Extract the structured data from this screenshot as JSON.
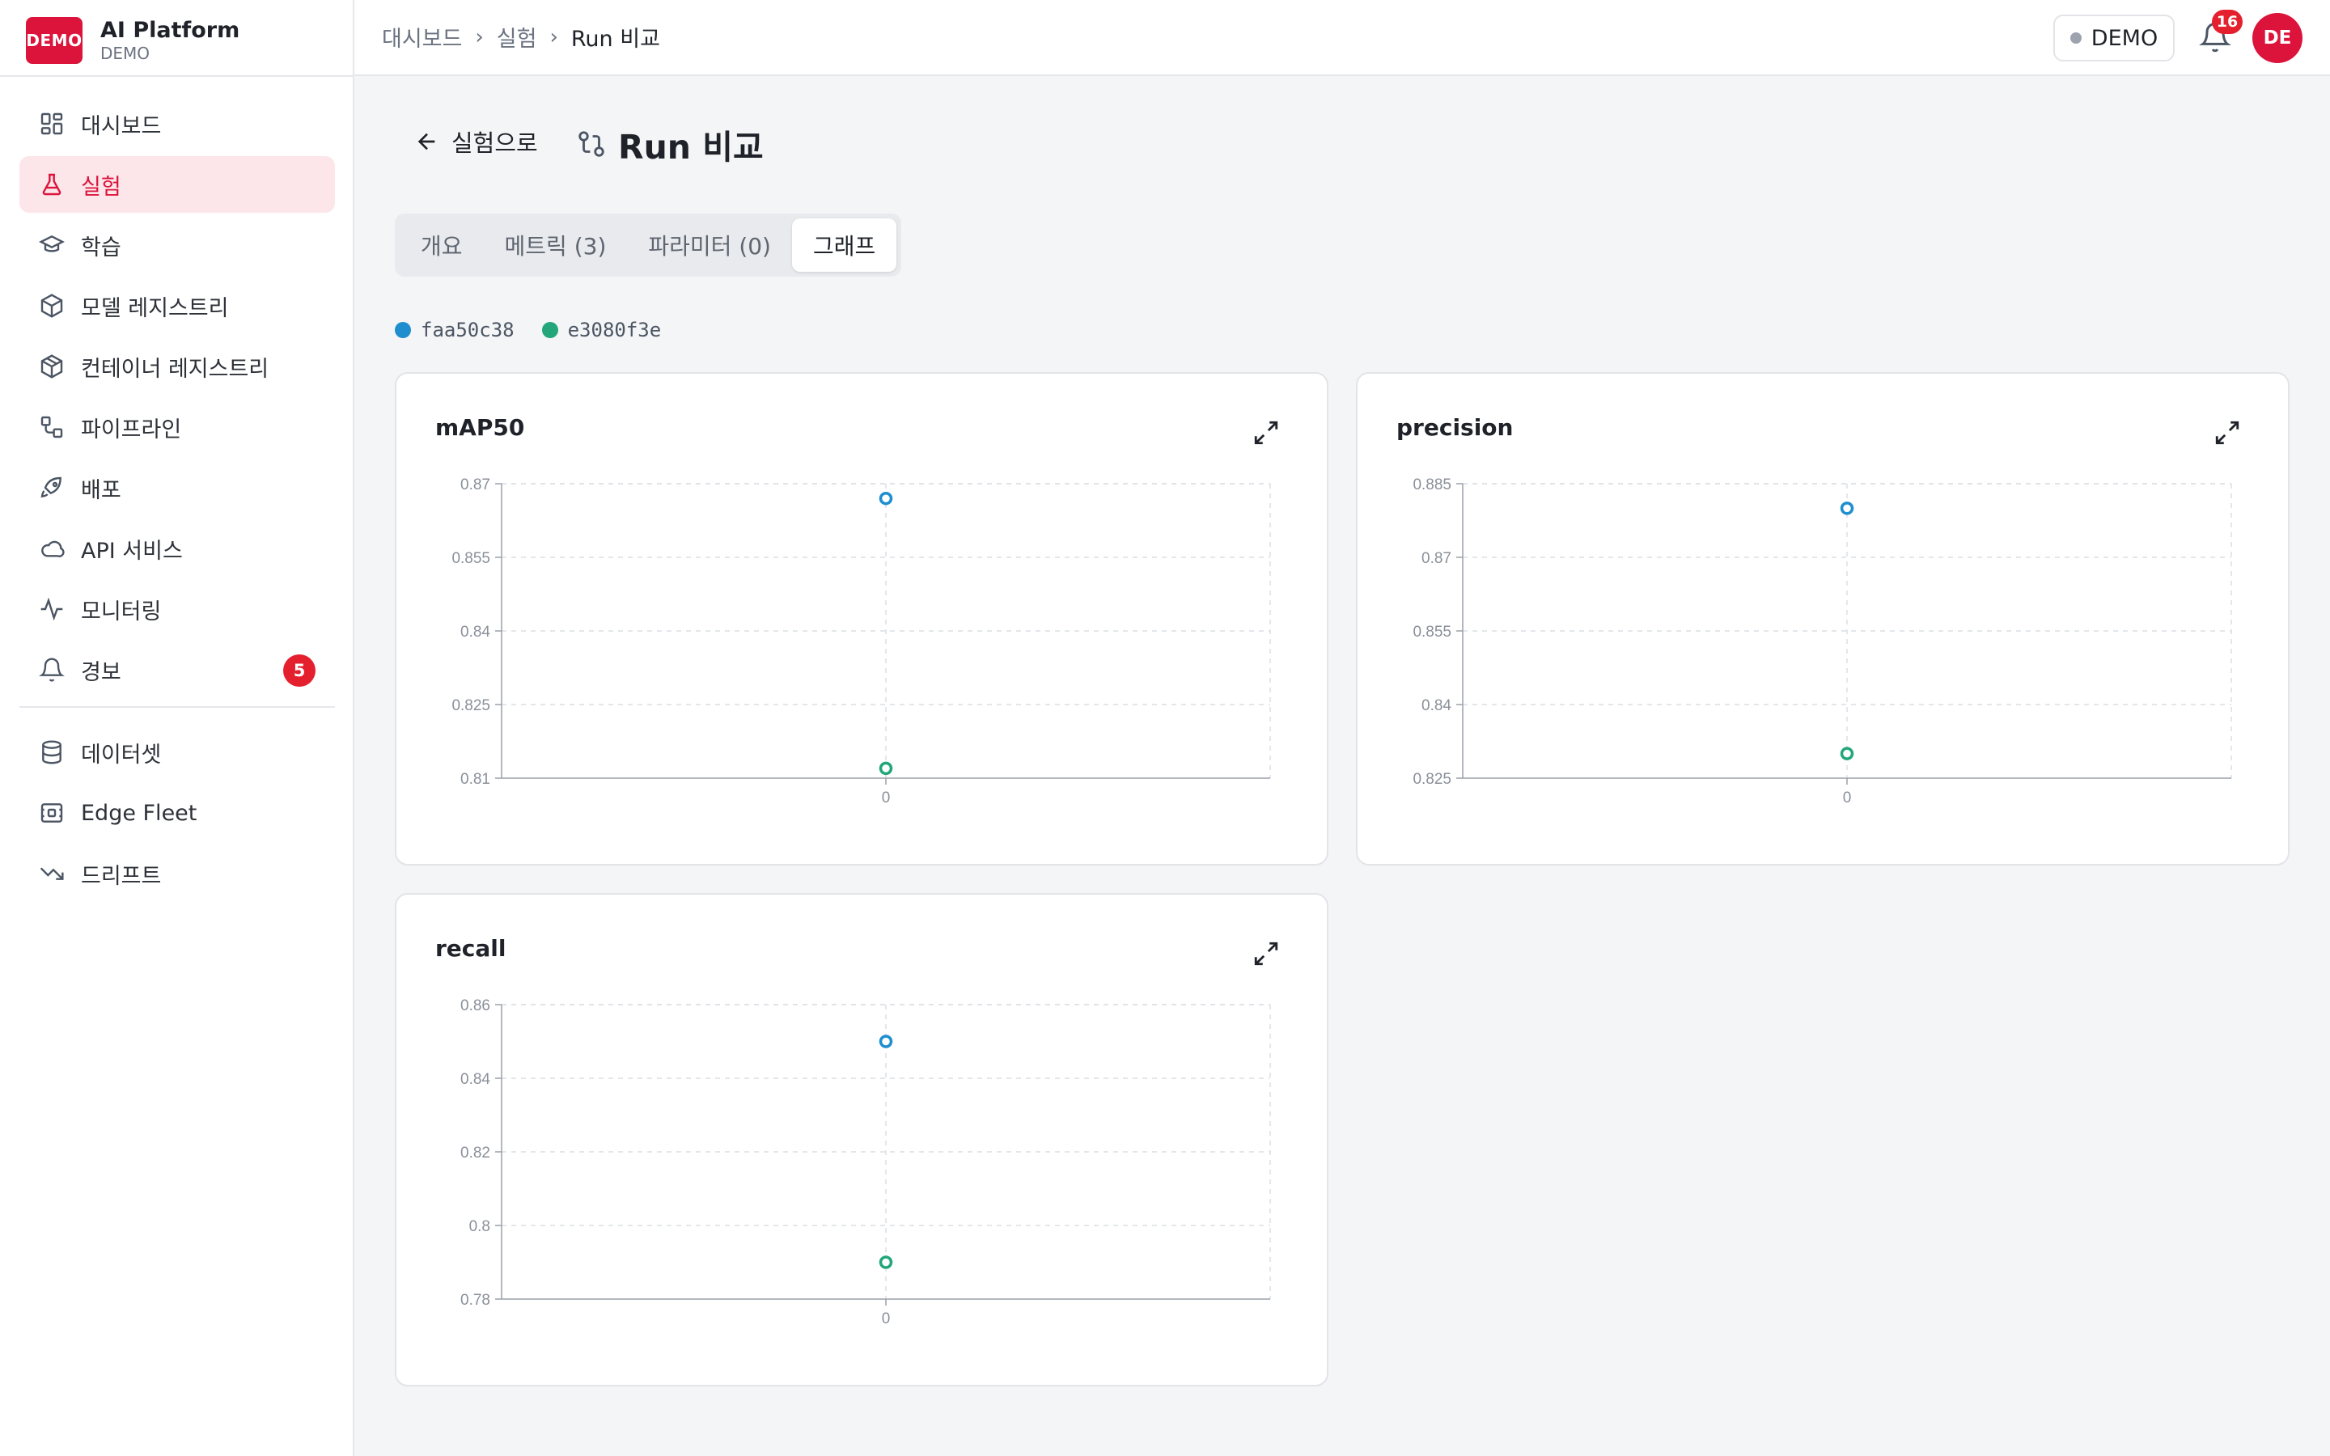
{
  "brand": {
    "logo": "DEMO",
    "title": "AI Platform",
    "subtitle": "DEMO"
  },
  "sidebar": {
    "items": [
      {
        "label": "대시보드",
        "icon": "dashboard-icon"
      },
      {
        "label": "실험",
        "icon": "flask-icon",
        "active": true
      },
      {
        "label": "학습",
        "icon": "graduation-cap-icon"
      },
      {
        "label": "모델 레지스트리",
        "icon": "box-icon"
      },
      {
        "label": "컨테이너 레지스트리",
        "icon": "container-icon"
      },
      {
        "label": "파이프라인",
        "icon": "pipeline-icon"
      },
      {
        "label": "배포",
        "icon": "rocket-icon"
      },
      {
        "label": "API 서비스",
        "icon": "cloud-icon"
      },
      {
        "label": "모니터링",
        "icon": "activity-icon"
      },
      {
        "label": "경보",
        "icon": "bell-icon",
        "badge": "5"
      }
    ],
    "secondary": [
      {
        "label": "데이터셋",
        "icon": "database-icon"
      },
      {
        "label": "Edge Fleet",
        "icon": "edge-device-icon"
      },
      {
        "label": "드리프트",
        "icon": "trending-down-icon"
      }
    ]
  },
  "topbar": {
    "breadcrumb": [
      "대시보드",
      "실험",
      "Run 비교"
    ],
    "env_label": "DEMO",
    "notifications": "16",
    "avatar": "DE"
  },
  "page": {
    "back_label": "실험으로",
    "title": "Run 비교"
  },
  "tabs": [
    "개요",
    "메트릭 (3)",
    "파라미터 (0)",
    "그래프"
  ],
  "active_tab": "그래프",
  "runs": [
    {
      "id": "faa50c38",
      "color": "#1f8ecf"
    },
    {
      "id": "e3080f3e",
      "color": "#22a67a"
    }
  ],
  "colors": {
    "accent": "#dc143c",
    "active_bg": "#fde6ea"
  },
  "chart_data": [
    {
      "type": "scatter",
      "title": "mAP50",
      "x_ticks": [
        "0"
      ],
      "y_ticks": [
        "0.87",
        "0.855",
        "0.84",
        "0.825",
        "0.81"
      ],
      "ylim": [
        0.81,
        0.87
      ],
      "grid": true,
      "series": [
        {
          "name": "faa50c38",
          "x": [
            0
          ],
          "y": [
            0.867
          ]
        },
        {
          "name": "e3080f3e",
          "x": [
            0
          ],
          "y": [
            0.812
          ]
        }
      ]
    },
    {
      "type": "scatter",
      "title": "precision",
      "x_ticks": [
        "0"
      ],
      "y_ticks": [
        "0.885",
        "0.87",
        "0.855",
        "0.84",
        "0.825"
      ],
      "ylim": [
        0.825,
        0.885
      ],
      "grid": true,
      "series": [
        {
          "name": "faa50c38",
          "x": [
            0
          ],
          "y": [
            0.88
          ]
        },
        {
          "name": "e3080f3e",
          "x": [
            0
          ],
          "y": [
            0.83
          ]
        }
      ]
    },
    {
      "type": "scatter",
      "title": "recall",
      "x_ticks": [
        "0"
      ],
      "y_ticks": [
        "0.86",
        "0.84",
        "0.82",
        "0.8",
        "0.78"
      ],
      "ylim": [
        0.78,
        0.86
      ],
      "grid": true,
      "series": [
        {
          "name": "faa50c38",
          "x": [
            0
          ],
          "y": [
            0.85
          ]
        },
        {
          "name": "e3080f3e",
          "x": [
            0
          ],
          "y": [
            0.79
          ]
        }
      ]
    }
  ]
}
